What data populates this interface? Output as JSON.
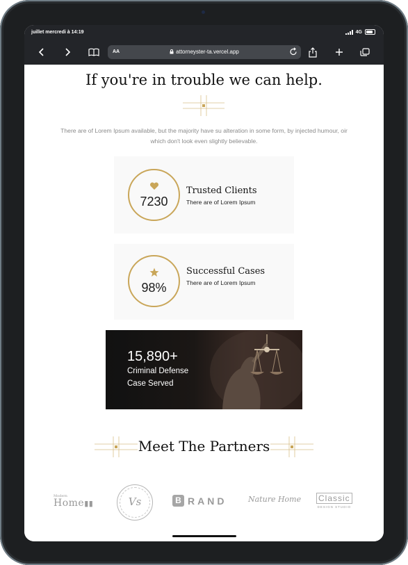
{
  "status_bar": {
    "time": "juillet mercredi à 14:19",
    "network": "4G"
  },
  "browser": {
    "text_size": "AA",
    "url": "attorneyster-ta.vercel.app"
  },
  "page": {
    "heading": "If you're in trouble we can help.",
    "intro": "There are of Lorem Ipsum available, but the majority have su alteration in some form, by injected humour, oir which don't look even slightly believable.",
    "stats": [
      {
        "icon": "heart-icon",
        "value": "7230",
        "title": "Trusted Clients",
        "subtitle": "There are of Lorem Ipsum"
      },
      {
        "icon": "star-icon",
        "value": "98%",
        "title": "Successful Cases",
        "subtitle": "There are of Lorem Ipsum"
      }
    ],
    "banner": {
      "number": "15,890+",
      "line1": "Criminal Defense",
      "line2": "Case Served"
    },
    "partners": {
      "title": "Meet The Partners",
      "logos": [
        {
          "top": "Modern",
          "main": "Home"
        },
        {
          "main": "Vs"
        },
        {
          "badge": "B",
          "main": "RAND"
        },
        {
          "main": "Nature Home"
        },
        {
          "main": "Classic",
          "sub": "DESIGN STUDIO"
        }
      ]
    }
  },
  "colors": {
    "accent": "#c9a659",
    "browser_chrome": "#232529",
    "card_bg": "#f9f9f9"
  }
}
